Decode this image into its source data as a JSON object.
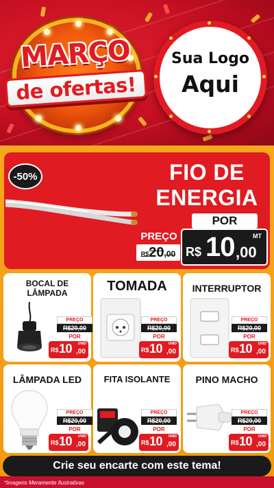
{
  "header": {
    "headline_line1": "MARÇO",
    "headline_line2": "de ofertas!",
    "logo_line1": "Sua Logo",
    "logo_line2": "Aqui"
  },
  "hero": {
    "discount_badge": "-50%",
    "title_line1": "FIO DE",
    "title_line2": "ENERGIA",
    "por_label": "POR",
    "preco_label": "PREÇO",
    "old_currency": "R$",
    "old_value": "20",
    "old_cents": ",00",
    "currency": "R$",
    "price": "10",
    "cents": ",00",
    "unit": "MT"
  },
  "products": [
    {
      "title_line1": "BOCAL DE",
      "title_line2": "LÂMPADA",
      "preco_label": "PREÇO",
      "old_price": "R$20,00",
      "por_label": "POR",
      "currency": "R$",
      "price": "10",
      "cents": ",00",
      "unit": "UNID",
      "icon": "lamp-socket-icon"
    },
    {
      "title_line1": "TOMADA",
      "title_line2": "",
      "preco_label": "PREÇO",
      "old_price": "R$20,00",
      "por_label": "POR",
      "currency": "R$",
      "price": "10",
      "cents": ",00",
      "unit": "UNID",
      "icon": "wall-outlet-icon"
    },
    {
      "title_line1": "INTERRUPTOR",
      "title_line2": "",
      "preco_label": "PREÇO",
      "old_price": "R$20,00",
      "por_label": "POR",
      "currency": "R$",
      "price": "10",
      "cents": ",00",
      "unit": "UNID",
      "icon": "light-switch-icon"
    },
    {
      "title_line1": "LÂMPADA LED",
      "title_line2": "",
      "preco_label": "PREÇO",
      "old_price": "R$20,00",
      "por_label": "POR",
      "currency": "R$",
      "price": "10",
      "cents": ",00",
      "unit": "UNID",
      "icon": "led-bulb-icon"
    },
    {
      "title_line1": "FITA ISOLANTE",
      "title_line2": "",
      "preco_label": "PREÇO",
      "old_price": "R$20,00",
      "por_label": "POR",
      "currency": "R$",
      "price": "10",
      "cents": ",00",
      "unit": "UNID",
      "icon": "insulating-tape-icon"
    },
    {
      "title_line1": "PINO MACHO",
      "title_line2": "",
      "preco_label": "PREÇO",
      "old_price": "R$20,00",
      "por_label": "POR",
      "currency": "R$",
      "price": "10",
      "cents": ",00",
      "unit": "UNID",
      "icon": "plug-icon"
    }
  ],
  "cta": {
    "label": "Crie seu encarte com este tema!"
  },
  "footnote": "*Imagens Meramente Ilustrativas",
  "colors": {
    "brand_red": "#e11b22",
    "panel_yellow": "#f6a81c",
    "dark": "#1a1a1a"
  }
}
